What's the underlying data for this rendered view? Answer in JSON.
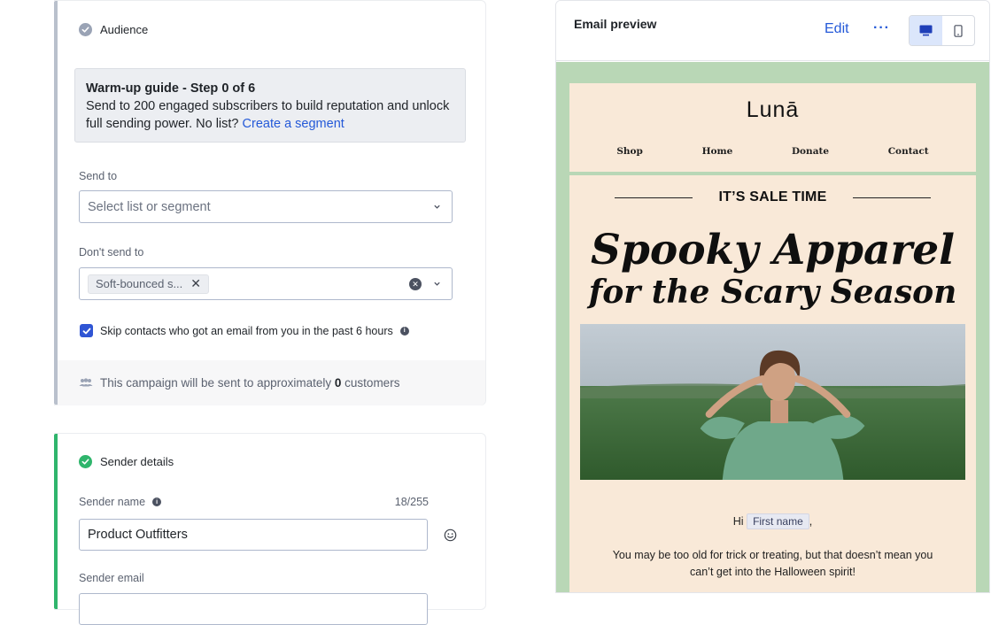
{
  "audience": {
    "title": "Audience",
    "guide": {
      "title": "Warm-up guide - Step 0 of 6",
      "text": "Send to 200 engaged subscribers to build reputation and unlock full sending power. No list?",
      "link": "Create a segment"
    },
    "send_to": {
      "label": "Send to",
      "placeholder": "Select list or segment"
    },
    "dont_send_to": {
      "label": "Don't send to",
      "chip": "Soft-bounced s..."
    },
    "skip_label": "Skip contacts who got an email from you in the past 6 hours",
    "estimate_prefix": "This campaign will be sent to approximately",
    "estimate_count": "0",
    "estimate_suffix": "customers"
  },
  "sender": {
    "title": "Sender details",
    "name_label": "Sender name",
    "name_counter": "18/255",
    "name_value": "Product Outfitters",
    "email_label": "Sender email"
  },
  "preview": {
    "title": "Email preview",
    "edit": "Edit",
    "more": "···",
    "email": {
      "logo": "Lunā",
      "menu": [
        "Shop",
        "Home",
        "Donate",
        "Contact"
      ],
      "sale": "IT’S SALE TIME",
      "headline_1": "Spooky Apparel",
      "headline_2": "for the Scary Season",
      "greeting_prefix": "Hi",
      "greeting_tag": "First name",
      "greeting_suffix": ",",
      "body": "You may be too old for trick or treating, but that doesn’t mean you can’t get into the Halloween spirit!"
    }
  },
  "colors": {
    "accent": "#2459d8",
    "sender_rail": "#2fb56c",
    "audience_rail": "#b9c0cc",
    "email_bg": "#f9e9d8",
    "email_frame": "#b9d7b6"
  }
}
